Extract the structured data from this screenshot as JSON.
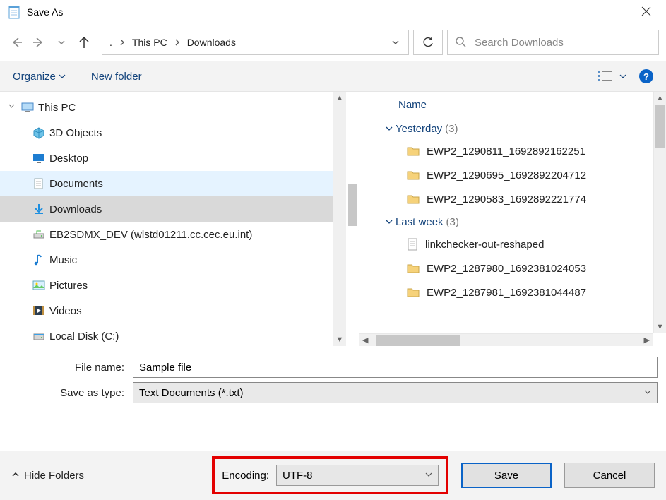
{
  "window": {
    "title": "Save As"
  },
  "nav": {
    "breadcrumbs": {
      "root": ".",
      "pc": "This PC",
      "folder": "Downloads"
    },
    "search_placeholder": "Search Downloads"
  },
  "toolbar": {
    "organize": "Organize",
    "new_folder": "New folder"
  },
  "tree": {
    "root": "This PC",
    "items": [
      {
        "label": "3D Objects"
      },
      {
        "label": "Desktop"
      },
      {
        "label": "Documents"
      },
      {
        "label": "Downloads"
      },
      {
        "label": "EB2SDMX_DEV (wlstd01211.cc.cec.eu.int)"
      },
      {
        "label": "Music"
      },
      {
        "label": "Pictures"
      },
      {
        "label": "Videos"
      },
      {
        "label": "Local Disk (C:)"
      }
    ]
  },
  "files": {
    "column_header": "Name",
    "groups": [
      {
        "label": "Yesterday",
        "count": "(3)",
        "items": [
          {
            "type": "folder",
            "name": "EWP2_1290811_1692892162251"
          },
          {
            "type": "folder",
            "name": "EWP2_1290695_1692892204712"
          },
          {
            "type": "folder",
            "name": "EWP2_1290583_1692892221774"
          }
        ]
      },
      {
        "label": "Last week",
        "count": "(3)",
        "items": [
          {
            "type": "text",
            "name": "linkchecker-out-reshaped"
          },
          {
            "type": "folder",
            "name": "EWP2_1287980_1692381024053"
          },
          {
            "type": "folder",
            "name": "EWP2_1287981_1692381044487"
          }
        ]
      }
    ]
  },
  "fields": {
    "filename_label": "File name:",
    "filename_value": "Sample file",
    "type_label": "Save as type:",
    "type_value": "Text Documents (*.txt)"
  },
  "footer": {
    "hide_folders": "Hide Folders",
    "encoding_label": "Encoding:",
    "encoding_value": "UTF-8",
    "save": "Save",
    "cancel": "Cancel"
  }
}
